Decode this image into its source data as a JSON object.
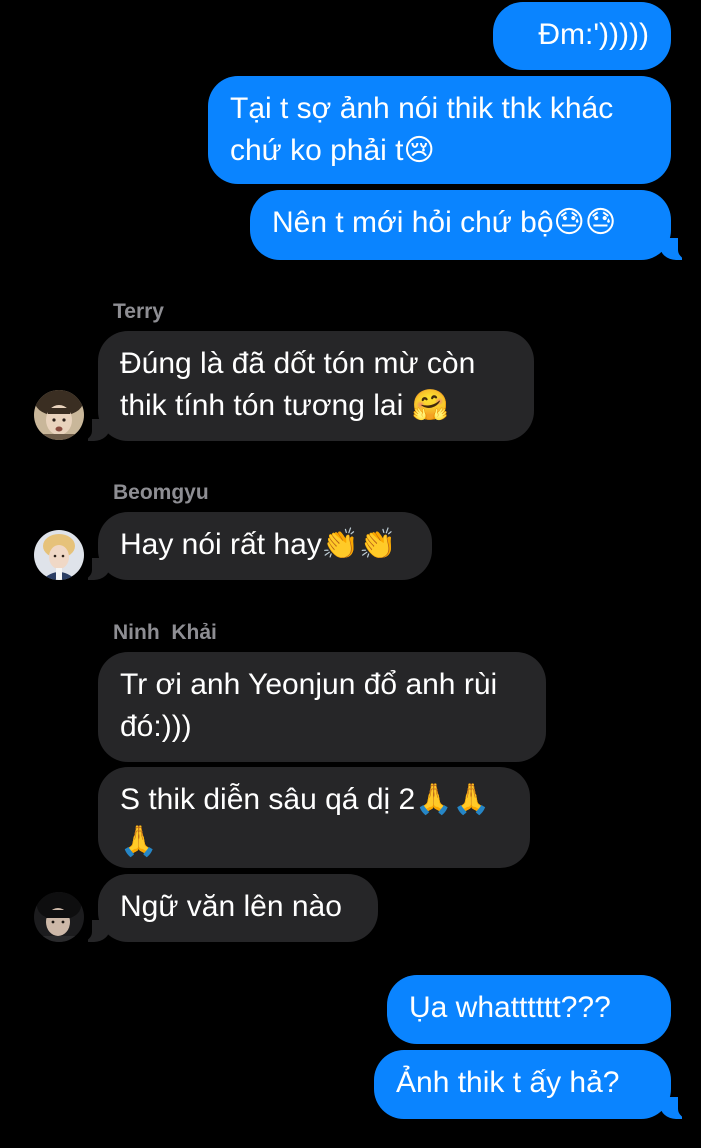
{
  "messages": [
    {
      "text": "Đm:')))))"
    },
    {
      "text": "Tại t sợ ảnh nói thik thk khác\nchứ ko phải t😢"
    },
    {
      "text": "Nên t mới hỏi chứ bộ😓😓"
    },
    {
      "sender": "Terry",
      "text": "Đúng là đã dốt tón mừ còn\nthik tính tón tương lai 🤗"
    },
    {
      "sender": "Beomgyu",
      "text": "Hay nói rất hay👏👏"
    },
    {
      "sender": "Ninh  Khải",
      "text": "Tr ơi anh Yeonjun đổ anh rùi\nđó:)))"
    },
    {
      "text": "S thik diễn sâu qá dị 2🙏🙏\n🙏"
    },
    {
      "text": "Ngữ văn lên nào"
    },
    {
      "text": "Ụa whatttttt???"
    },
    {
      "text": "Ảnh thik t ấy hả?"
    }
  ],
  "colors": {
    "outgoing_bubble": "#0a84ff",
    "incoming_bubble": "#262628",
    "sender_name": "#8e8e93",
    "background": "#000000"
  }
}
